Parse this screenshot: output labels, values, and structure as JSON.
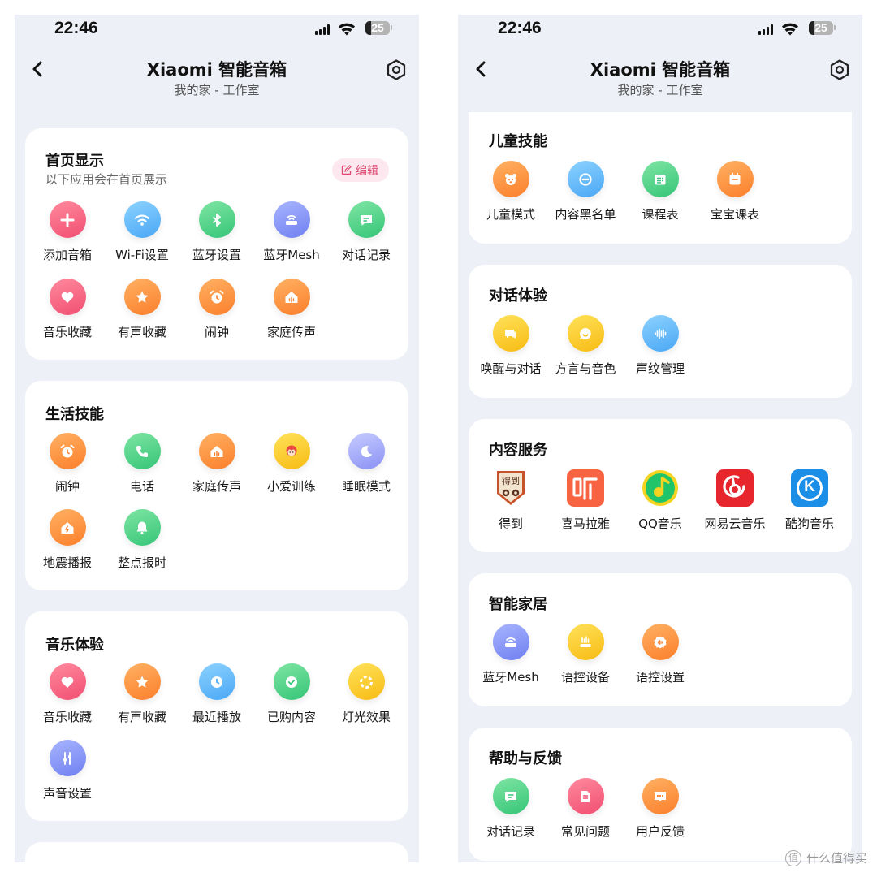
{
  "status": {
    "time": "22:46",
    "battery": "25"
  },
  "header": {
    "title": "Xiaomi 智能音箱",
    "subtitle": "我的家 - 工作室"
  },
  "left": {
    "home_display": {
      "title": "首页显示",
      "subtitle": "以下应用会在首页展示",
      "edit_label": "编辑",
      "items": [
        {
          "label": "添加音箱",
          "icon": "plus-icon",
          "color": "red"
        },
        {
          "label": "Wi-Fi设置",
          "icon": "wifi-icon",
          "color": "blue"
        },
        {
          "label": "蓝牙设置",
          "icon": "bluetooth-icon",
          "color": "green"
        },
        {
          "label": "蓝牙Mesh",
          "icon": "router-icon",
          "color": "indigo"
        },
        {
          "label": "对话记录",
          "icon": "chat-icon",
          "color": "green"
        },
        {
          "label": "音乐收藏",
          "icon": "heart-icon",
          "color": "red"
        },
        {
          "label": "有声收藏",
          "icon": "star-icon",
          "color": "orange"
        },
        {
          "label": "闹钟",
          "icon": "alarm-icon",
          "color": "orange"
        },
        {
          "label": "家庭传声",
          "icon": "home-icon",
          "color": "orange"
        }
      ]
    },
    "life_skills": {
      "title": "生活技能",
      "items": [
        {
          "label": "闹钟",
          "icon": "alarm-icon",
          "color": "orange"
        },
        {
          "label": "电话",
          "icon": "phone-icon",
          "color": "green"
        },
        {
          "label": "家庭传声",
          "icon": "home-icon",
          "color": "orange"
        },
        {
          "label": "小爱训练",
          "icon": "avatar-icon",
          "color": "yellow"
        },
        {
          "label": "睡眠模式",
          "icon": "moon-icon",
          "color": "lavender"
        },
        {
          "label": "地震播报",
          "icon": "earthquake-icon",
          "color": "orange"
        },
        {
          "label": "整点报时",
          "icon": "bell-icon",
          "color": "green"
        }
      ]
    },
    "music": {
      "title": "音乐体验",
      "items": [
        {
          "label": "音乐收藏",
          "icon": "heart-icon",
          "color": "red"
        },
        {
          "label": "有声收藏",
          "icon": "star-icon",
          "color": "orange"
        },
        {
          "label": "最近播放",
          "icon": "clock-icon",
          "color": "blue"
        },
        {
          "label": "已购内容",
          "icon": "check-icon",
          "color": "green"
        },
        {
          "label": "灯光效果",
          "icon": "light-icon",
          "color": "yellow"
        },
        {
          "label": "声音设置",
          "icon": "equalizer-icon",
          "color": "indigo"
        }
      ]
    }
  },
  "right": {
    "kids": {
      "title": "儿童技能",
      "items": [
        {
          "label": "儿童模式",
          "icon": "bear-icon",
          "color": "orange"
        },
        {
          "label": "内容黑名单",
          "icon": "block-icon",
          "color": "blue"
        },
        {
          "label": "课程表",
          "icon": "calendar-icon",
          "color": "green"
        },
        {
          "label": "宝宝课表",
          "icon": "schedule-icon",
          "color": "orange"
        }
      ]
    },
    "dialog": {
      "title": "对话体验",
      "items": [
        {
          "label": "唤醒与对话",
          "icon": "speech-icon",
          "color": "yellow"
        },
        {
          "label": "方言与音色",
          "icon": "smile-icon",
          "color": "yellow"
        },
        {
          "label": "声纹管理",
          "icon": "voiceprint-icon",
          "color": "blue"
        }
      ]
    },
    "content": {
      "title": "内容服务",
      "items": [
        {
          "label": "得到",
          "icon": "dedao-logo-icon",
          "logo_text": "得到"
        },
        {
          "label": "喜马拉雅",
          "icon": "ximalaya-logo-icon"
        },
        {
          "label": "QQ音乐",
          "icon": "qqmusic-logo-icon"
        },
        {
          "label": "网易云音乐",
          "icon": "netease-logo-icon"
        },
        {
          "label": "酷狗音乐",
          "icon": "kugou-logo-icon",
          "logo_text": "K"
        }
      ]
    },
    "smart_home": {
      "title": "智能家居",
      "items": [
        {
          "label": "蓝牙Mesh",
          "icon": "router-icon",
          "color": "indigo"
        },
        {
          "label": "语控设备",
          "icon": "speaker-device-icon",
          "color": "yellow"
        },
        {
          "label": "语控设置",
          "icon": "gear-voice-icon",
          "color": "orange"
        }
      ]
    },
    "help": {
      "title": "帮助与反馈",
      "items": [
        {
          "label": "对话记录",
          "icon": "chat-icon",
          "color": "green"
        },
        {
          "label": "常见问题",
          "icon": "document-icon",
          "color": "red"
        },
        {
          "label": "用户反馈",
          "icon": "feedback-icon",
          "color": "orange"
        }
      ]
    }
  },
  "watermark": "什么值得买"
}
